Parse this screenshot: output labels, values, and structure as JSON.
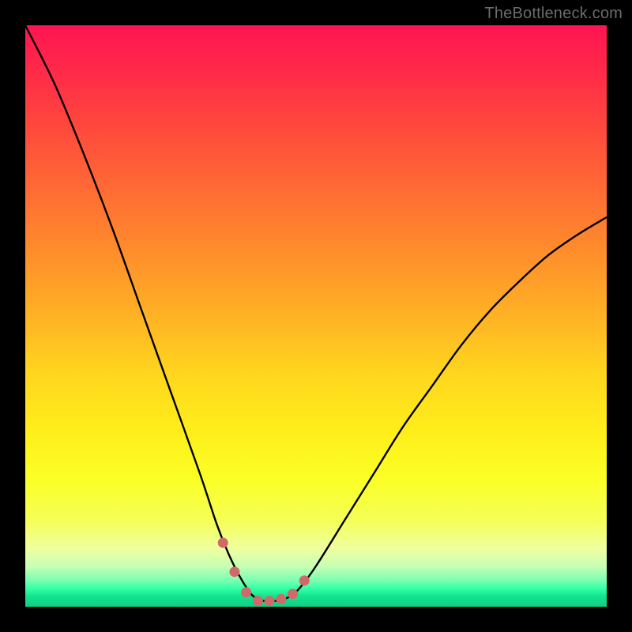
{
  "watermark": "TheBottleneck.com",
  "colors": {
    "frame": "#000000",
    "curve_stroke": "#000000",
    "markers": "#d06a6a",
    "gradient_top": "#ff1452",
    "gradient_bottom": "#0fd084"
  },
  "chart_data": {
    "type": "line",
    "title": "",
    "xlabel": "",
    "ylabel": "",
    "xlim": [
      0,
      100
    ],
    "ylim": [
      0,
      100
    ],
    "x": [
      0,
      5,
      10,
      15,
      20,
      25,
      30,
      33,
      35,
      37,
      39,
      41,
      43,
      45,
      47,
      50,
      55,
      60,
      65,
      70,
      75,
      80,
      85,
      90,
      95,
      100
    ],
    "values": [
      100,
      90,
      78,
      65,
      51,
      37,
      23,
      14,
      9,
      5,
      2,
      1,
      1,
      1.5,
      3,
      7,
      15,
      23,
      31,
      38,
      45,
      51,
      56,
      60.5,
      64,
      67
    ],
    "series": [
      {
        "name": "curve",
        "x": [
          0,
          5,
          10,
          15,
          20,
          25,
          30,
          33,
          35,
          37,
          39,
          41,
          43,
          45,
          47,
          50,
          55,
          60,
          65,
          70,
          75,
          80,
          85,
          90,
          95,
          100
        ],
        "values": [
          100,
          90,
          78,
          65,
          51,
          37,
          23,
          14,
          9,
          5,
          2,
          1,
          1,
          1.5,
          3,
          7,
          15,
          23,
          31,
          38,
          45,
          51,
          56,
          60.5,
          64,
          67
        ]
      }
    ],
    "minimum_markers_x": [
      34,
      36,
      38,
      40,
      42,
      44,
      46,
      48
    ],
    "minimum_markers_y": [
      11,
      6,
      2.5,
      1,
      1,
      1.3,
      2.2,
      4.5
    ]
  }
}
